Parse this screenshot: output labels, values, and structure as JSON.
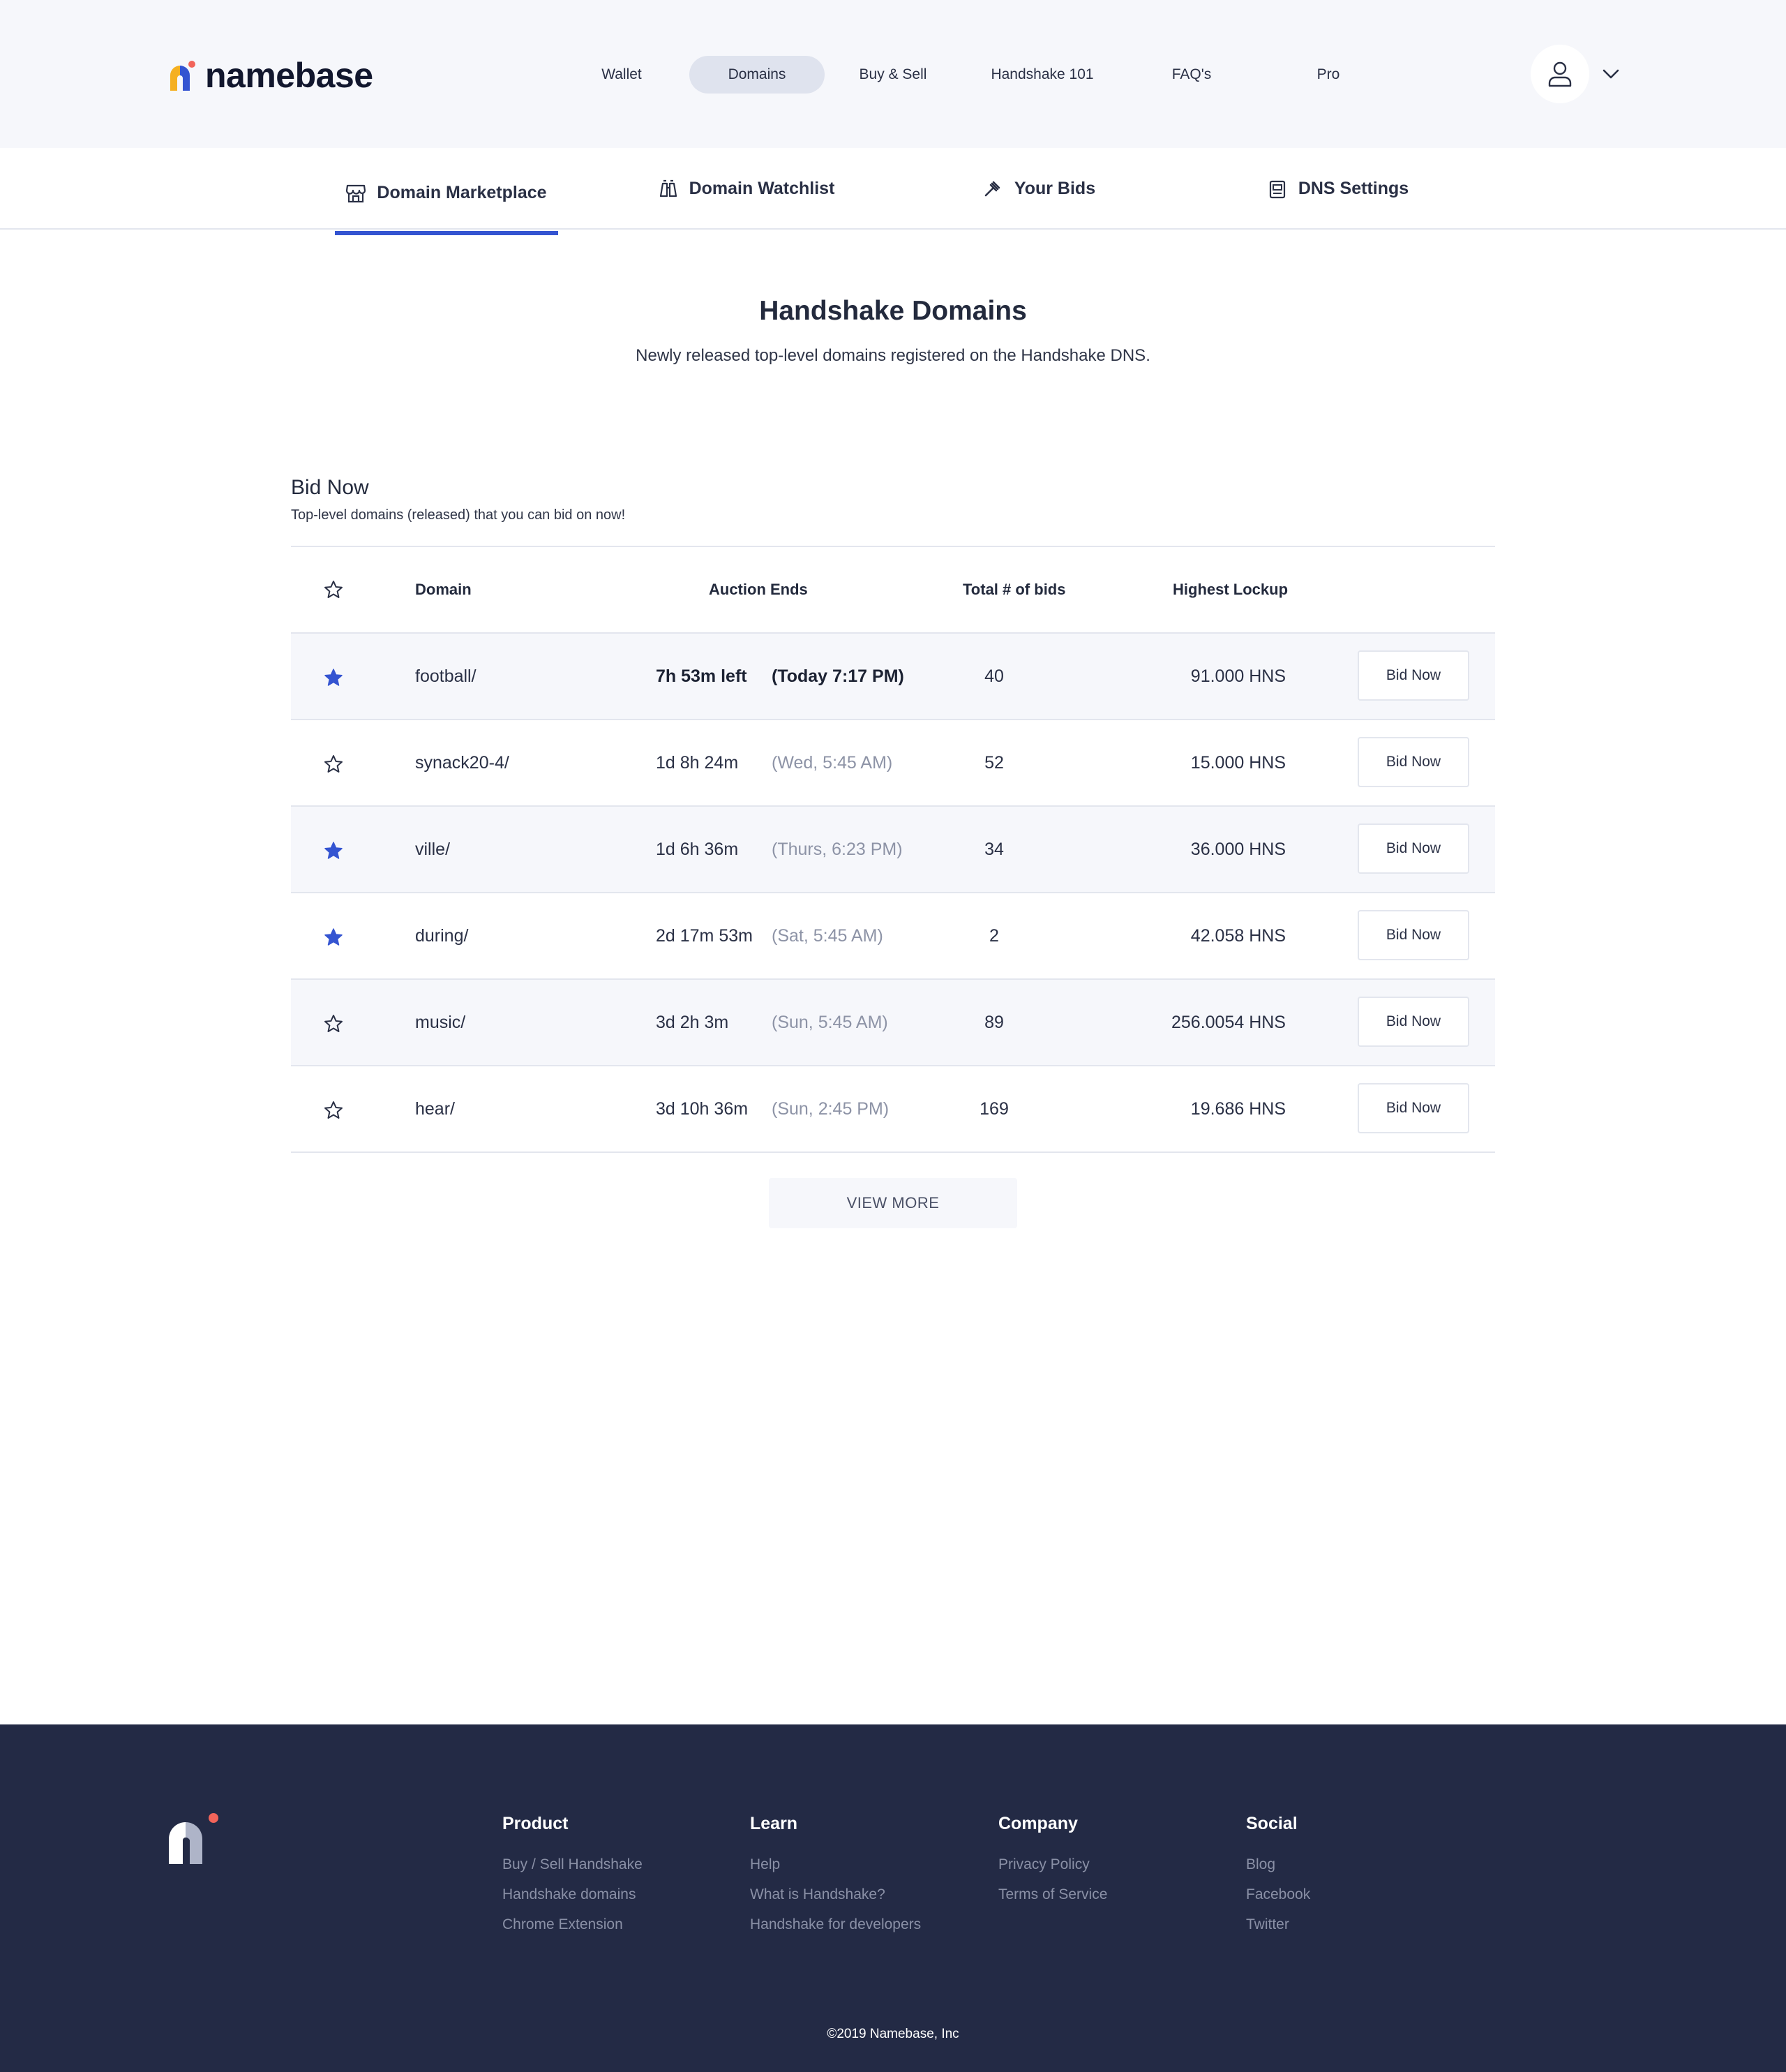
{
  "header": {
    "logo_text": "namebase",
    "nav": [
      "Wallet",
      "Domains",
      "Buy & Sell",
      "Handshake 101",
      "FAQ's",
      "Pro"
    ],
    "active_nav": "Domains"
  },
  "tabs": [
    {
      "label": "Domain Marketplace",
      "icon": "storefront-icon",
      "active": true
    },
    {
      "label": "Domain Watchlist",
      "icon": "binoculars-icon",
      "active": false
    },
    {
      "label": "Your Bids",
      "icon": "gavel-icon",
      "active": false
    },
    {
      "label": "DNS Settings",
      "icon": "server-icon",
      "active": false
    }
  ],
  "hero": {
    "title": "Handshake Domains",
    "subtitle": "Newly released top-level domains registered on the Handshake DNS."
  },
  "section": {
    "title": "Bid Now",
    "subtitle": "Top-level domains (released) that you can bid on now!"
  },
  "table": {
    "headers": {
      "domain": "Domain",
      "auction_ends": "Auction Ends",
      "total_bids": "Total # of bids",
      "highest_lockup": "Highest Lockup"
    },
    "button_label": "Bid Now",
    "rows": [
      {
        "starred": true,
        "domain": "football/",
        "remaining": "7h 53m left",
        "ends": "(Today 7:17 PM)",
        "bids": "40",
        "lockup": "91.000 HNS",
        "emphasis": true
      },
      {
        "starred": false,
        "domain": "synack20-4/",
        "remaining": "1d 8h 24m",
        "ends": "(Wed, 5:45 AM)",
        "bids": "52",
        "lockup": "15.000 HNS",
        "emphasis": false
      },
      {
        "starred": true,
        "domain": "ville/",
        "remaining": "1d 6h 36m",
        "ends": "(Thurs, 6:23 PM)",
        "bids": "34",
        "lockup": "36.000 HNS",
        "emphasis": false
      },
      {
        "starred": true,
        "domain": "during/",
        "remaining": "2d 17m 53m",
        "ends": "(Sat, 5:45 AM)",
        "bids": "2",
        "lockup": "42.058 HNS",
        "emphasis": false
      },
      {
        "starred": false,
        "domain": "music/",
        "remaining": "3d 2h 3m",
        "ends": "(Sun, 5:45 AM)",
        "bids": "89",
        "lockup": "256.0054 HNS",
        "emphasis": false
      },
      {
        "starred": false,
        "domain": "hear/",
        "remaining": "3d 10h 36m",
        "ends": "(Sun, 2:45 PM)",
        "bids": "169",
        "lockup": "19.686 HNS",
        "emphasis": false
      }
    ]
  },
  "view_more": "VIEW MORE",
  "footer": {
    "columns": [
      {
        "heading": "Product",
        "links": [
          "Buy / Sell Handshake",
          "Handshake domains",
          "Chrome Extension"
        ]
      },
      {
        "heading": "Learn",
        "links": [
          "Help",
          "What is Handshake?",
          "Handshake for developers"
        ]
      },
      {
        "heading": "Company",
        "links": [
          "Privacy Policy",
          "Terms of Service"
        ]
      },
      {
        "heading": "Social",
        "links": [
          "Blog",
          "Facebook",
          "Twitter"
        ]
      }
    ],
    "copyright": "©2019 Namebase, Inc"
  },
  "colors": {
    "accent": "#3454d1",
    "header_bg": "#f6f7fb",
    "footer_bg": "#232a45",
    "logo_yellow": "#f5b021",
    "logo_blue": "#3454d1",
    "logo_dot": "#f2645a"
  }
}
